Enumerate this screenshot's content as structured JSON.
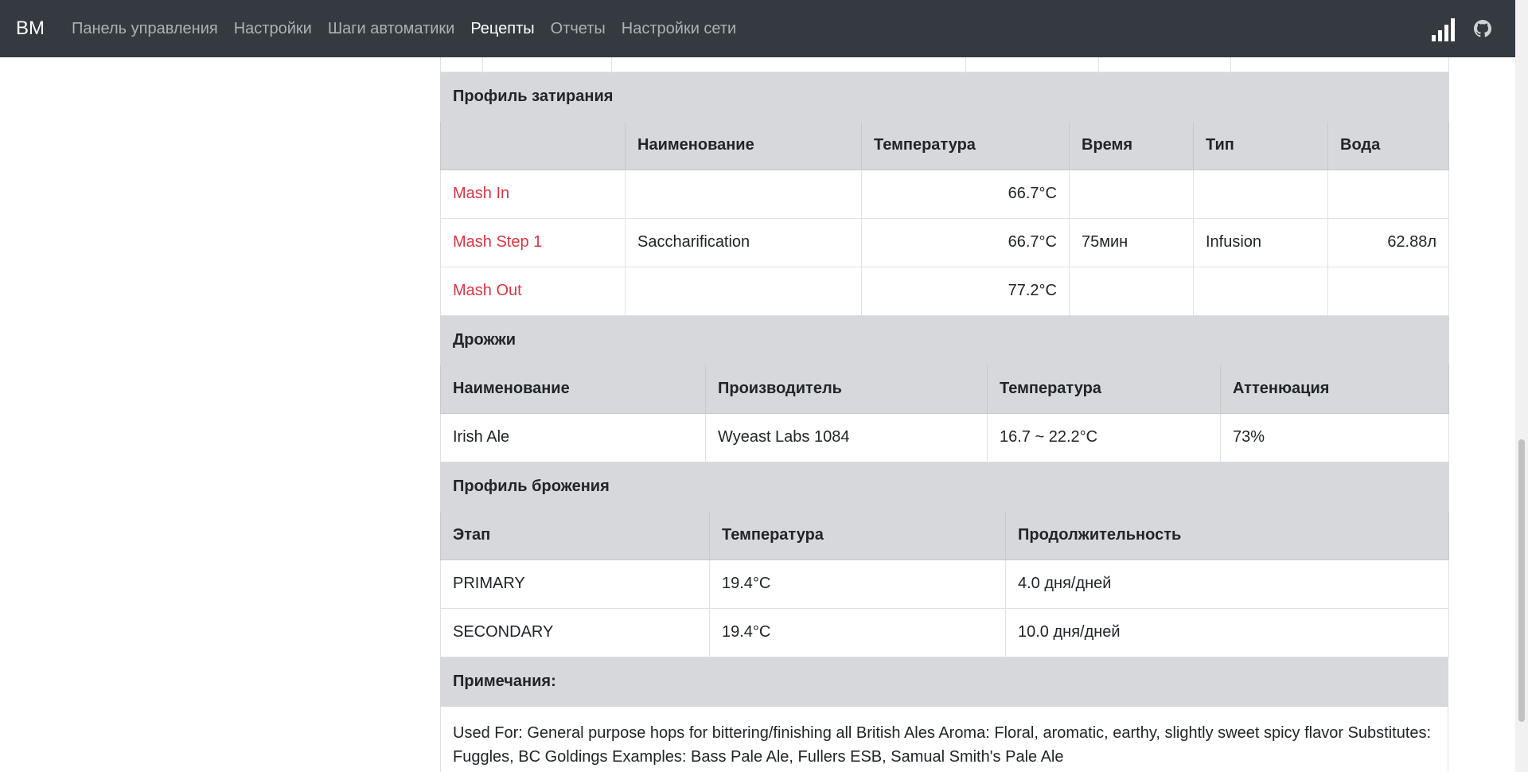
{
  "navbar": {
    "brand": "BM",
    "items": [
      {
        "label": "Панель управления",
        "active": false
      },
      {
        "label": "Настройки",
        "active": false
      },
      {
        "label": "Шаги автоматики",
        "active": false
      },
      {
        "label": "Рецепты",
        "active": true
      },
      {
        "label": "Отчеты",
        "active": false
      },
      {
        "label": "Настройки сети",
        "active": false
      }
    ],
    "icons": [
      "signal-icon",
      "github-icon"
    ]
  },
  "mash": {
    "title": "Профиль затирания",
    "headers": [
      "",
      "Наименование",
      "Температура",
      "Время",
      "Тип",
      "Вода"
    ],
    "rows": [
      {
        "step": "Mash In",
        "name": "",
        "temp": "66.7°C",
        "time": "",
        "type": "",
        "water": ""
      },
      {
        "step": "Mash Step 1",
        "name": "Saccharification",
        "temp": "66.7°C",
        "time": "75мин",
        "type": "Infusion",
        "water": "62.88л"
      },
      {
        "step": "Mash Out",
        "name": "",
        "temp": "77.2°C",
        "time": "",
        "type": "",
        "water": ""
      }
    ]
  },
  "yeast": {
    "title": "Дрожжи",
    "headers": [
      "Наименование",
      "Производитель",
      "Температура",
      "Аттенюация"
    ],
    "rows": [
      {
        "name": "Irish Ale",
        "lab": "Wyeast Labs 1084",
        "temp": "16.7 ~ 22.2°C",
        "attenuation": "73%"
      }
    ]
  },
  "fermentation": {
    "title": "Профиль брожения",
    "headers": [
      "Этап",
      "Температура",
      "Продолжительность"
    ],
    "rows": [
      {
        "stage": "PRIMARY",
        "temp": "19.4°C",
        "duration": "4.0 дня/дней"
      },
      {
        "stage": "SECONDARY",
        "temp": "19.4°C",
        "duration": "10.0 дня/дней"
      }
    ]
  },
  "notes": {
    "title": "Примечания:",
    "text": "Used For: General purpose hops for bittering/finishing all British Ales Aroma: Floral, aromatic, earthy, slightly sweet spicy flavor Substitutes: Fuggles, BC Goldings Examples: Bass Pale Ale, Fullers ESB, Samual Smith's Pale Ale"
  }
}
